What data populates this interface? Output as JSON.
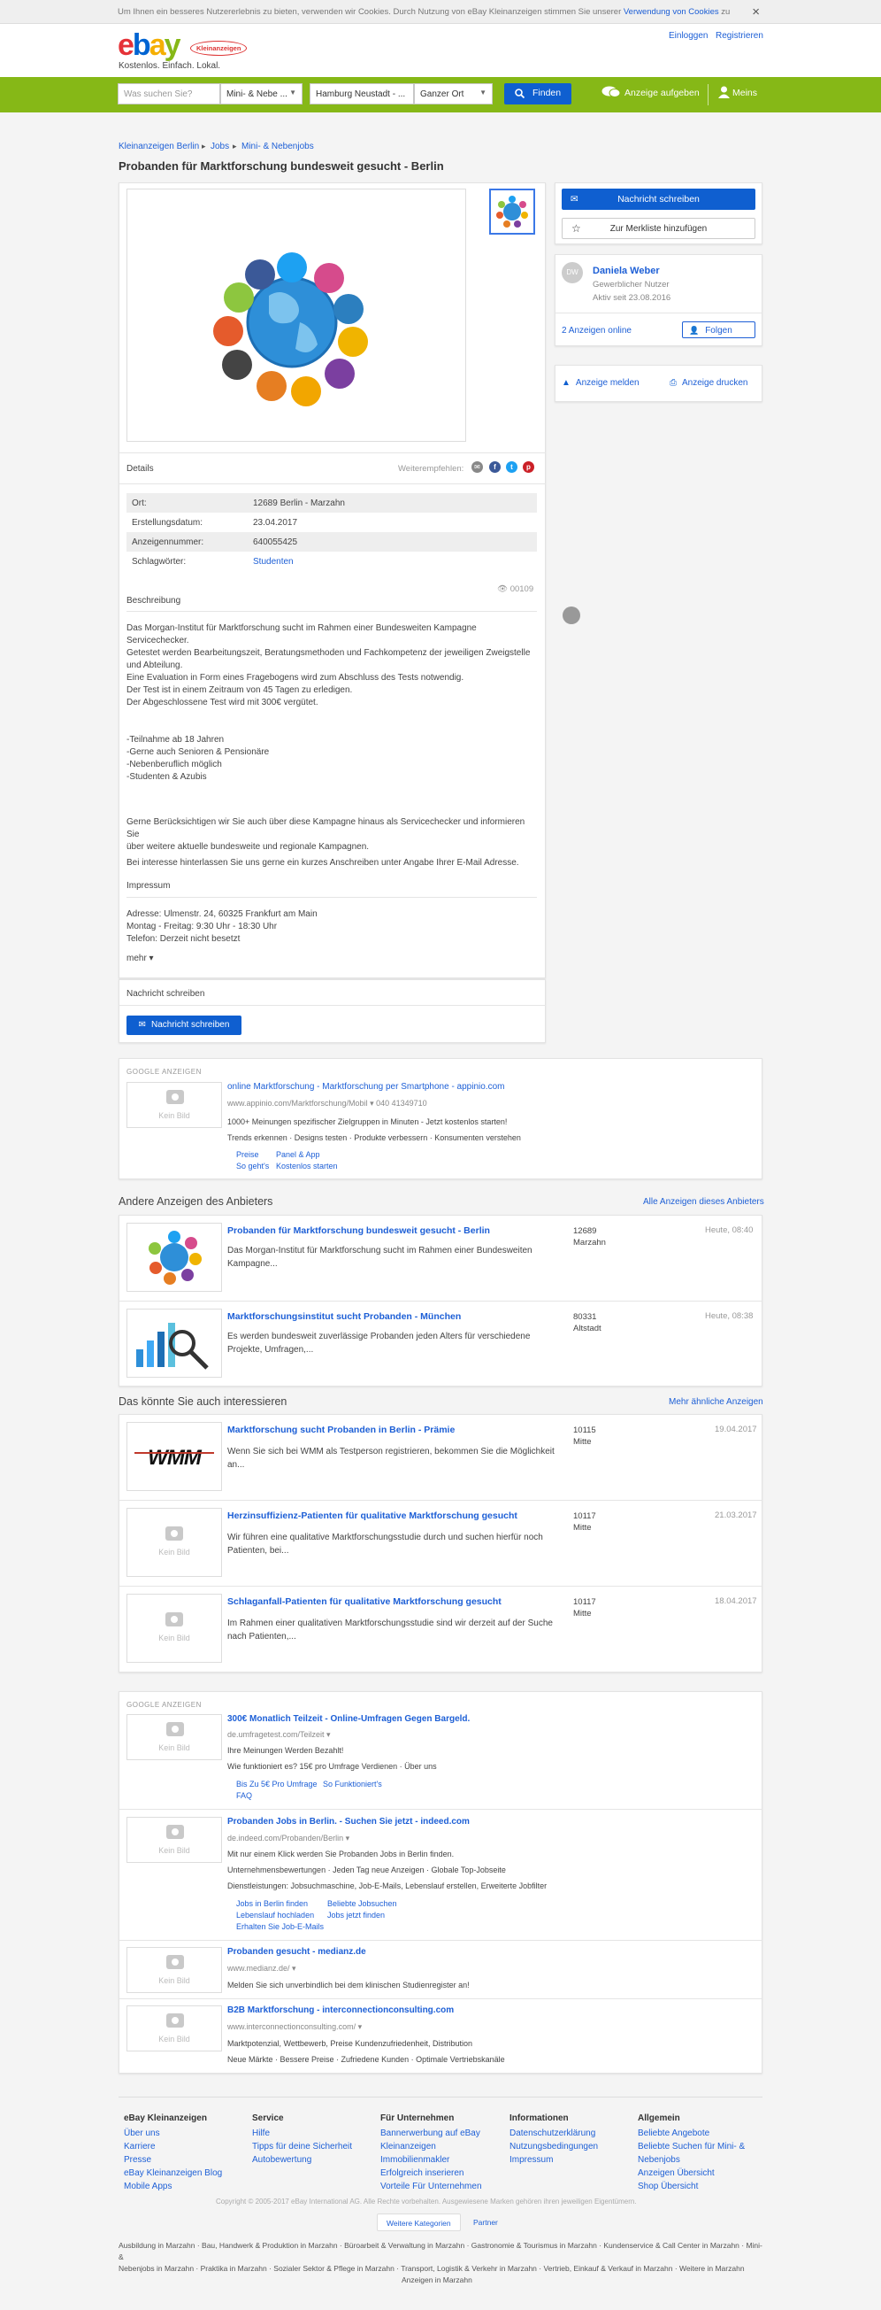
{
  "cookie": {
    "text": "Um Ihnen ein besseres Nutzererlebnis zu bieten, verwenden wir Cookies. Durch Nutzung von eBay Kleinanzeigen stimmen Sie unserer ",
    "link": "Verwendung von Cookies",
    "end": " zu",
    "close": "×"
  },
  "header": {
    "logo_e": "e",
    "logo_b": "b",
    "logo_a": "a",
    "logo_y": "y",
    "badge": "Kleinanzeigen",
    "slogan": "Kostenlos. Einfach. Lokal.",
    "login": "Einloggen",
    "register": "Registrieren"
  },
  "search": {
    "placeholder": "Was suchen Sie?",
    "category": "Mini- & Nebe ...",
    "location": "Hamburg Neustadt - ...",
    "radius": "Ganzer Ort",
    "find": "Finden",
    "post": "Anzeige aufgeben",
    "mine": "Meins"
  },
  "breadcrumb": [
    "Kleinanzeigen Berlin",
    "Jobs",
    "Mini- & Nebenjobs"
  ],
  "title": "Probanden für Marktforschung bundesweit gesucht - Berlin",
  "details": {
    "heading": "Details",
    "share": "Weiterempfehlen:",
    "rows": [
      {
        "label": "Ort:",
        "value": "12689 Berlin - Marzahn"
      },
      {
        "label": "Erstellungsdatum:",
        "value": "23.04.2017"
      },
      {
        "label": "Anzeigennummer:",
        "value": "640055425"
      },
      {
        "label": "Schlagwörter:",
        "value": "Studenten"
      }
    ],
    "views": "00109"
  },
  "description": {
    "heading": "Beschreibung",
    "p1": [
      "Das Morgan-Institut für Marktforschung sucht im Rahmen einer Bundesweiten Kampagne Servicechecker.",
      "Getestet werden Bearbeitungszeit, Beratungsmethoden und Fachkompetenz der jeweiligen Zweigstelle",
      "und Abteilung.",
      "Eine Evaluation in Form eines Fragebogens wird zum Abschluss des Tests notwendig.",
      "Der Test ist in einem Zeitraum von 45 Tagen zu erledigen.",
      "Der Abgeschlossene Test wird mit 300€ vergütet."
    ],
    "p2": [
      "-Teilnahme ab 18 Jahren",
      "-Gerne auch Senioren & Pensionäre",
      "-Nebenberuflich möglich",
      "-Studenten & Azubis"
    ],
    "p3": [
      "Gerne Berücksichtigen wir Sie auch über diese Kampagne hinaus als Servicechecker und informieren Sie",
      "über weitere aktuelle bundesweite und regionale Kampagnen."
    ],
    "p4": "Bei interesse hinterlassen Sie uns gerne ein kurzes Anschreiben unter Angabe Ihrer E-Mail Adresse.",
    "imprint": "Impressum",
    "addr": [
      "Adresse: Ulmenstr. 24, 60325 Frankfurt am Main",
      "Montag - Freitag: 9:30 Uhr - 18:30 Uhr",
      "Telefon: Derzeit nicht besetzt"
    ],
    "more": "mehr ▾"
  },
  "message": {
    "heading": "Nachricht schreiben",
    "button": "Nachricht schreiben"
  },
  "sidebar": {
    "write": "Nachricht schreiben",
    "watch": "Zur Merkliste hinzufügen",
    "avatar": "DW",
    "name": "Daniela Weber",
    "type": "Gewerblicher Nutzer",
    "active": "Aktiv seit 23.08.2016",
    "ads": "2 Anzeigen online",
    "follow": "Folgen",
    "report": "Anzeige melden",
    "print": "Anzeige drucken"
  },
  "google1": {
    "label": "GOOGLE ANZEIGEN",
    "nopic": "Kein Bild",
    "title": "online Marktforschung - Marktforschung per Smartphone - appinio.com",
    "url": "www.appinio.com/Marktforschung/Mobil ▾    040 41349710",
    "l1": "1000+ Meinungen spezifischer Zielgruppen in Minuten - Jetzt kostenlos starten!",
    "l2": "Trends erkennen · Designs testen · Produkte verbessern · Konsumenten verstehen",
    "s1": "Preise",
    "s2": "Panel & App",
    "s3": "So geht's",
    "s4": "Kostenlos starten"
  },
  "other": {
    "heading": "Andere Anzeigen des Anbieters",
    "link": "Alle Anzeigen dieses Anbieters",
    "items": [
      {
        "title": "Probanden für Marktforschung bundesweit gesucht - Berlin",
        "desc": "Das Morgan-Institut für Marktforschung sucht im Rahmen einer Bundesweiten Kampagne...",
        "zip": "12689",
        "area": "Marzahn",
        "date": "Heute, 08:40"
      },
      {
        "title": "Marktforschungsinstitut sucht Probanden - München",
        "desc": "Es werden bundesweit zuverlässige Probanden jeden Alters für verschiedene Projekte, Umfragen,...",
        "zip": "80331",
        "area": "Altstadt",
        "date": "Heute, 08:38"
      }
    ]
  },
  "similar": {
    "heading": "Das könnte Sie auch interessieren",
    "link": "Mehr ähnliche Anzeigen",
    "nopic": "Kein Bild",
    "items": [
      {
        "title": "Marktforschung sucht Probanden in Berlin - Prämie",
        "desc": "Wenn Sie sich bei WMM als Testperson registrieren, bekommen Sie die Möglichkeit an...",
        "zip": "10115",
        "area": "Mitte",
        "date": "19.04.2017",
        "logo": "WMM"
      },
      {
        "title": "Herzinsuffizienz-Patienten für qualitative Marktforschung gesucht",
        "desc": "Wir führen eine qualitative Marktforschungsstudie durch und suchen hierfür noch Patienten, bei...",
        "zip": "10117",
        "area": "Mitte",
        "date": "21.03.2017"
      },
      {
        "title": "Schlaganfall-Patienten für qualitative Marktforschung gesucht",
        "desc": "Im Rahmen einer qualitativen Marktforschungsstudie sind wir derzeit auf der Suche nach Patienten,...",
        "zip": "10117",
        "area": "Mitte",
        "date": "18.04.2017"
      }
    ]
  },
  "google2": {
    "label": "GOOGLE ANZEIGEN",
    "nopic": "Kein Bild",
    "ads": [
      {
        "title": "300€ Monatlich Teilzeit - Online-Umfragen Gegen Bargeld.",
        "url": "de.umfragetest.com/Teilzeit ▾",
        "l1": "Ihre Meinungen Werden Bezahlt!",
        "l2": "Wie funktioniert es?   15€ pro Umfrage Verdienen · Über uns",
        "s1": "Bis Zu 5€ Pro Umfrage",
        "s2": "So Funktioniert's",
        "s3": "FAQ"
      },
      {
        "title": "Probanden Jobs in Berlin. - Suchen Sie jetzt - indeed.com",
        "url": "de.indeed.com/Probanden/Berlin ▾",
        "l1": "Mit nur einem Klick werden Sie Probanden Jobs in Berlin finden.",
        "l2": "Unternehmensbewertungen · Jeden Tag neue Anzeigen · Globale Top-Jobseite",
        "l3": "Dienstleistungen: Jobsuchmaschine, Job-E-Mails, Lebenslauf erstellen, Erweiterte Jobfilter",
        "s1": "Jobs in Berlin finden",
        "s2": "Beliebte Jobsuchen",
        "s3": "Lebenslauf hochladen",
        "s4": "Jobs jetzt finden",
        "s5": "Erhalten Sie Job-E-Mails"
      },
      {
        "title": "Probanden gesucht - medianz.de",
        "url": "www.medianz.de/ ▾",
        "l1": "Melden Sie sich unverbindlich bei dem klinischen Studienregister an!"
      },
      {
        "title": "B2B Marktforschung - interconnectionconsulting.com",
        "url": "www.interconnectionconsulting.com/ ▾",
        "l1": "Marktpotenzial, Wettbewerb, Preise Kundenzufriedenheit, Distribution",
        "l2": "Neue Märkte · Bessere Preise · Zufriedene Kunden · Optimale Vertriebskanäle"
      }
    ]
  },
  "footer": {
    "cols": [
      {
        "h": "eBay Kleinanzeigen",
        "links": [
          "Über uns",
          "Karriere",
          "Presse",
          "eBay Kleinanzeigen Blog",
          "Mobile Apps"
        ]
      },
      {
        "h": "Service",
        "links": [
          "Hilfe",
          "Tipps für deine Sicherheit",
          "Autobewertung"
        ]
      },
      {
        "h": "Für Unternehmen",
        "links": [
          "Bannerwerbung auf eBay",
          "Kleinanzeigen",
          "Immobilienmakler",
          "Erfolgreich inserieren",
          "Vorteile Für Unternehmen"
        ]
      },
      {
        "h": "Informationen",
        "links": [
          "Datenschutzerklärung",
          "Nutzungsbedingungen",
          "Impressum"
        ]
      },
      {
        "h": "Allgemein",
        "links": [
          "Beliebte Angebote",
          "Beliebte Suchen für Mini- &",
          "Nebenjobs",
          "Anzeigen Übersicht",
          "Shop Übersicht"
        ]
      }
    ],
    "copy": "Copyright © 2005-2017 eBay International AG. Alle Rechte vorbehalten. Ausgewiesene Marken gehören ihren jeweiligen Eigentümern.",
    "btn1": "Weitere Kategorien",
    "btn2": "Partner",
    "cats1": "Ausbildung in Marzahn · Bau, Handwerk & Produktion in Marzahn · Büroarbeit & Verwaltung in Marzahn · Gastronomie & Tourismus in Marzahn · Kundenservice & Call Center in Marzahn · Mini- &",
    "cats2": "Nebenjobs in Marzahn · Praktika in Marzahn · Sozialer Sektor & Pflege in Marzahn · Transport, Logistik & Verkehr in Marzahn · Vertrieb, Einkauf & Verkauf in Marzahn · Weitere in Marzahn",
    "cats3": "Anzeigen in Marzahn"
  },
  "colors": {
    "green": "#86b817",
    "blue": "#0f5fd0",
    "link": "#1d5fd6"
  }
}
